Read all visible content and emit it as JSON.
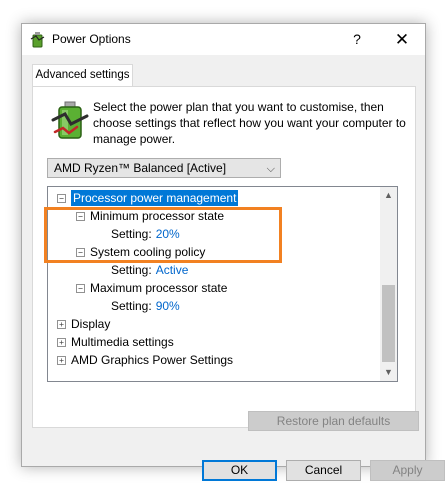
{
  "window": {
    "title": "Power Options",
    "help_glyph": "?",
    "close_glyph": "✕",
    "icon": "power-options-icon"
  },
  "tabs": [
    {
      "label": "Advanced settings"
    }
  ],
  "description": "Select the power plan that you want to customise, then choose settings that reflect how you want your computer to manage power.",
  "plan_select": {
    "selected": "AMD Ryzen™ Balanced [Active]"
  },
  "tree": {
    "processor_power_management": "Processor power management",
    "min_state": "Minimum processor state",
    "min_setting_label": "Setting:",
    "min_setting_value": "20%",
    "cooling": "System cooling policy",
    "cooling_setting_label": "Setting:",
    "cooling_setting_value": "Active",
    "max_state": "Maximum processor state",
    "max_setting_label": "Setting:",
    "max_setting_value": "90%",
    "display": "Display",
    "multimedia": "Multimedia settings",
    "amd_graphics": "AMD Graphics Power Settings"
  },
  "buttons": {
    "restore": "Restore plan defaults",
    "ok": "OK",
    "cancel": "Cancel",
    "apply": "Apply"
  },
  "colors": {
    "selection": "#0078d7",
    "value_text": "#0066cc",
    "highlight_box": "#f28121"
  }
}
